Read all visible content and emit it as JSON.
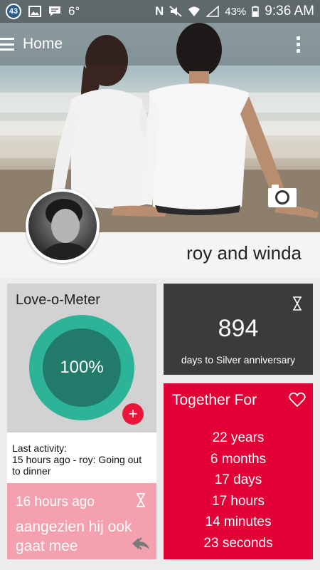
{
  "status_bar": {
    "badge": "43",
    "temperature": "6°",
    "network_letter": "N",
    "battery": "43%",
    "time": "9:36 AM"
  },
  "app_bar": {
    "title": "Home"
  },
  "profile": {
    "couple_name": "roy and winda"
  },
  "love_meter": {
    "title": "Love-o-Meter",
    "value_label": "100%",
    "add_label": "+"
  },
  "last_activity": {
    "label": "Last activity:",
    "text": "15 hours ago - roy: Going out to dinner"
  },
  "latest_message": {
    "time": "16 hours ago",
    "text": "aangezien hij ook gaat mee"
  },
  "countdown": {
    "days": "894",
    "caption": "days to Silver anniversary"
  },
  "together": {
    "title": "Together For",
    "lines": [
      "22 years",
      "6 months",
      "17 days",
      "17 hours",
      "14 minutes",
      "23 seconds"
    ]
  },
  "colors": {
    "meter_ring": "#2db397",
    "meter_core": "#217a6a",
    "accent_red": "#e30036",
    "pink": "#f4a0ae",
    "dark": "#3b3b3b"
  },
  "icons": [
    "menu-icon",
    "overflow-icon",
    "camera-icon",
    "hourglass-icon",
    "heart-icon",
    "reply-icon",
    "add-icon"
  ]
}
